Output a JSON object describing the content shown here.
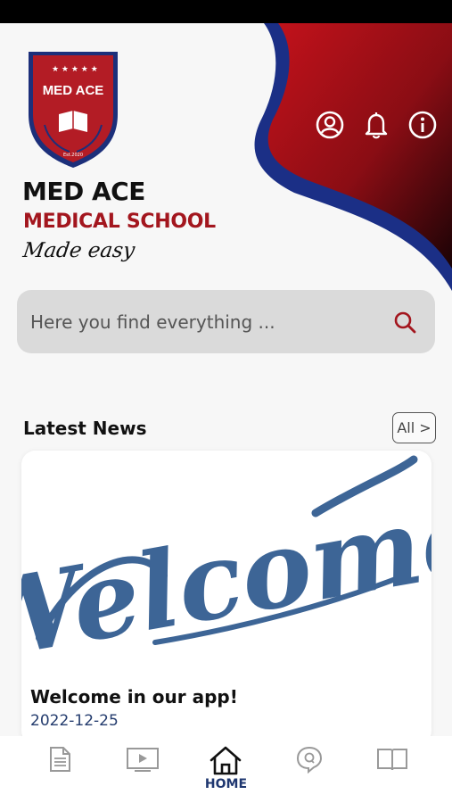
{
  "brand": {
    "logo_text": "MED ACE",
    "logo_est": "Est.2020",
    "name": "MED ACE",
    "subtitle": "MEDICAL SCHOOL",
    "tagline": "Made easy"
  },
  "header_icons": [
    "account-icon",
    "bell-icon",
    "info-icon"
  ],
  "search": {
    "placeholder": "Here you find everything ..."
  },
  "news": {
    "title": "Latest News",
    "all_label": "All >",
    "items": [
      {
        "image_text": "Welcome",
        "title": "Welcome in our app!",
        "date": "2022-12-25"
      }
    ]
  },
  "bottom_nav": {
    "items": [
      {
        "icon": "document-icon",
        "label": ""
      },
      {
        "icon": "video-icon",
        "label": ""
      },
      {
        "icon": "home-icon",
        "label": "HOME",
        "active": true
      },
      {
        "icon": "quiz-icon",
        "label": ""
      },
      {
        "icon": "book-icon",
        "label": ""
      }
    ]
  },
  "colors": {
    "accent_red": "#a3161e",
    "accent_blue": "#1f3770",
    "welcome_blue": "#3d6596"
  }
}
